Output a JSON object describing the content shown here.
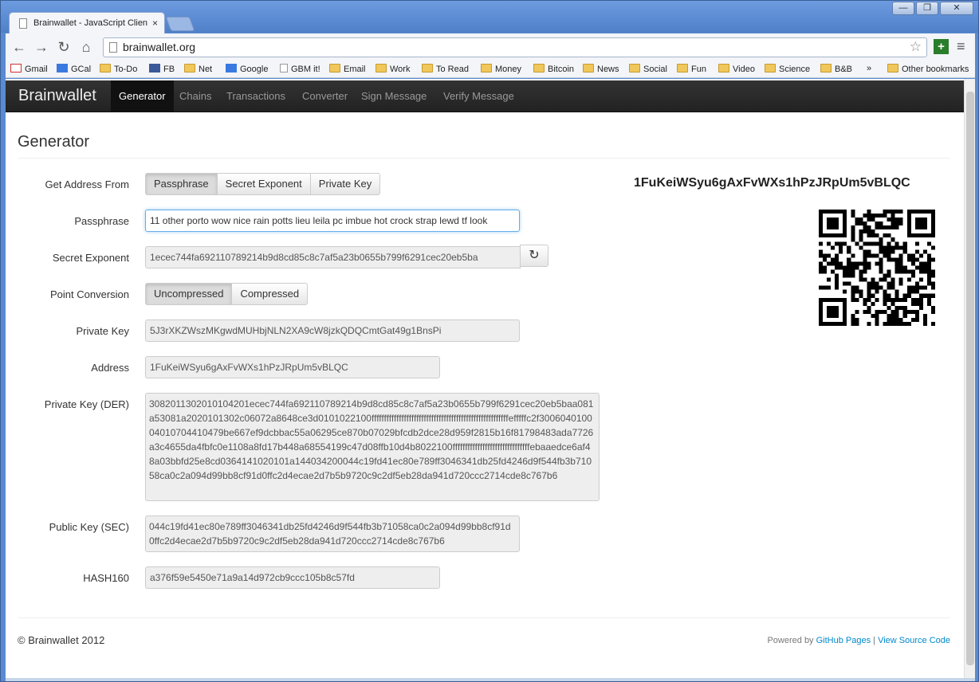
{
  "browser": {
    "tab_title": "Brainwallet - JavaScript Clien",
    "tab_close": "×",
    "url": "brainwallet.org",
    "window_buttons": [
      "—",
      "❐",
      "✕"
    ],
    "nav": {
      "back": "←",
      "forward": "→",
      "reload": "↻",
      "home": "⌂"
    },
    "star": "☆",
    "extension_label": "+",
    "menu": "≡",
    "bookmarks": [
      {
        "label": "Gmail",
        "icon": "gmail"
      },
      {
        "label": "GCal",
        "icon": "gcal"
      },
      {
        "label": "To-Do",
        "icon": "folder"
      },
      {
        "label": "FB",
        "icon": "fb"
      },
      {
        "label": "Net",
        "icon": "folder"
      },
      {
        "label": "Google",
        "icon": "google"
      },
      {
        "label": "GBM it!",
        "icon": "doc"
      },
      {
        "label": "Email",
        "icon": "folder"
      },
      {
        "label": "Work",
        "icon": "folder"
      },
      {
        "label": "To Read",
        "icon": "folder"
      },
      {
        "label": "Money",
        "icon": "folder"
      },
      {
        "label": "Bitcoin",
        "icon": "folder"
      },
      {
        "label": "News",
        "icon": "folder"
      },
      {
        "label": "Social",
        "icon": "folder"
      },
      {
        "label": "Fun",
        "icon": "folder"
      },
      {
        "label": "Video",
        "icon": "folder"
      },
      {
        "label": "Science",
        "icon": "folder"
      },
      {
        "label": "B&B",
        "icon": "folder"
      }
    ],
    "bookmarks_overflow": "»",
    "other_bookmarks": "Other bookmarks"
  },
  "navbar": {
    "brand": "Brainwallet",
    "items": [
      "Generator",
      "Chains",
      "Transactions",
      "Converter",
      "Sign Message",
      "Verify Message"
    ],
    "active": "Generator"
  },
  "page": {
    "title": "Generator",
    "address_display": "1FuKeiWSyu6gAxFvWXs1hPzJRpUm5vBLQC"
  },
  "form": {
    "get_address_label": "Get Address From",
    "get_address_options": [
      "Passphrase",
      "Secret Exponent",
      "Private Key"
    ],
    "passphrase_label": "Passphrase",
    "passphrase_value": "11 other porto wow nice rain potts lieu leila pc imbue hot crock strap lewd tf look",
    "secret_exponent_label": "Secret Exponent",
    "secret_exponent_value": "1ecec744fa692110789214b9d8cd85c8c7af5a23b0655b799f6291cec20eb5ba",
    "point_conversion_label": "Point Conversion",
    "point_conversion_options": [
      "Uncompressed",
      "Compressed"
    ],
    "private_key_label": "Private Key",
    "private_key_value": "5J3rXKZWszMKgwdMUHbjNLN2XA9cW8jzkQDQCmtGat49g1BnsPi",
    "address_label": "Address",
    "address_value": "1FuKeiWSyu6gAxFvWXs1hPzJRpUm5vBLQC",
    "der_label": "Private Key (DER)",
    "der_value": "3082011302010104201ecec744fa692110789214b9d8cd85c8c7af5a23b0655b799f6291cec20eb5baa081a53081a2020101302c06072a8648ce3d0101022100fffffffffffffffffffffffffffffffffffffffffffffffffffffffefffffc2f300604010004010704410479be667ef9dcbbac55a06295ce870b07029bfcdb2dce28d959f2815b16f81798483ada7726a3c4655da4fbfc0e1108a8fd17b448a68554199c47d08ffb10d4b8022100fffffffffffffffffffffffffffffffebaaedce6af48a03bbfd25e8cd0364141020101a144034200044c19fd41ec80e789ff3046341db25fd4246d9f544fb3b71058ca0c2a094d99bb8cf91d0ffc2d4ecae2d7b5b9720c9c2df5eb28da941d720ccc2714cde8c767b6",
    "pubkey_label": "Public Key (SEC)",
    "pubkey_value": "044c19fd41ec80e789ff3046341db25fd4246d9f544fb3b71058ca0c2a094d99bb8cf91d0ffc2d4ecae2d7b5b9720c9c2df5eb28da941d720ccc2714cde8c767b6",
    "hash160_label": "HASH160",
    "hash160_value": "a376f59e5450e71a9a14d972cb9ccc105b8c57fd",
    "refresh_icon": "↻"
  },
  "footer": {
    "copyright": "© Brainwallet 2012",
    "powered_by": "Powered by",
    "github_pages": "GitHub Pages",
    "separator": "|",
    "view_source": "View Source Code"
  }
}
